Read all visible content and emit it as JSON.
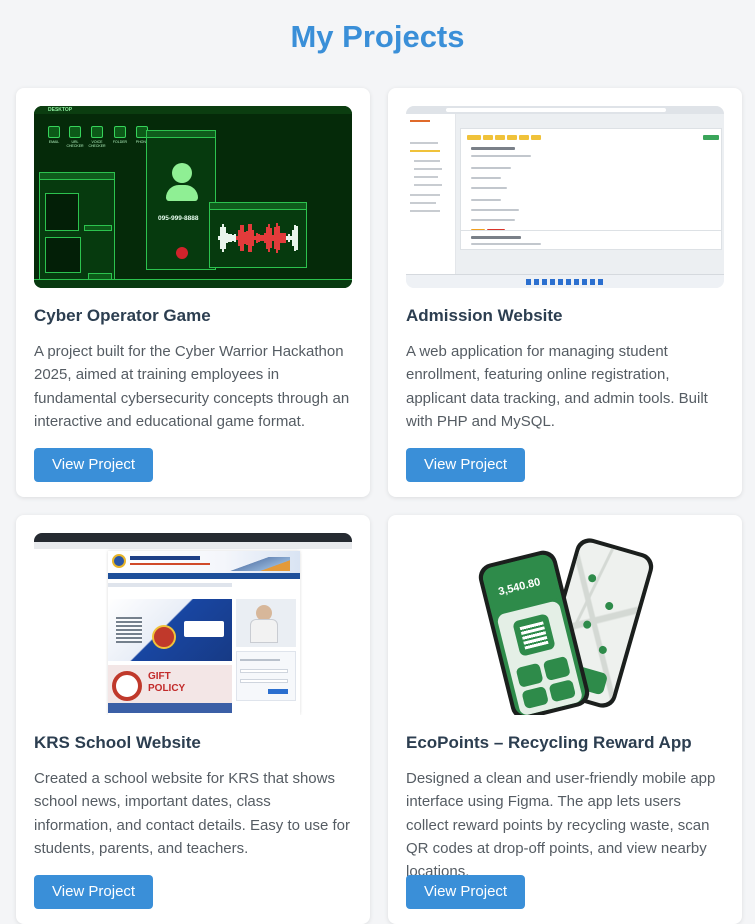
{
  "page": {
    "title": "My Projects"
  },
  "projects": [
    {
      "title": "Cyber Operator Game",
      "description": "A project built for the Cyber Warrior Hackathon 2025, aimed at training employees in fundamental cybersecurity concepts through an interactive and educational game format.",
      "button_label": "View Project",
      "thumbnail": {
        "desktop_label": "DESKTOP",
        "phone_number": "095-999-8888",
        "icon_labels": [
          "EMAIL",
          "URL CHECKER",
          "VOICE CHECKER",
          "FOLDER",
          "PHONE"
        ]
      }
    },
    {
      "title": "Admission Website",
      "description": "A web application for managing student enrollment, featuring online registration, applicant data tracking, and admin tools. Built with PHP and MySQL.",
      "button_label": "View Project"
    },
    {
      "title": "KRS School Website",
      "description": "Created a school website for KRS that shows school news, important dates, class information, and contact details. Easy to use for students, parents, and teachers.",
      "button_label": "View Project",
      "thumbnail": {
        "gift_text": "GIFT",
        "policy_text": "POLICY"
      }
    },
    {
      "title": "EcoPoints – Recycling Reward App",
      "description": "Designed a clean and user-friendly mobile app interface using Figma. The app lets users collect reward points by recycling waste, scan QR codes at drop-off points, and view nearby locations.",
      "button_label": "View Project",
      "thumbnail": {
        "points": "3,540.80"
      }
    }
  ],
  "colors": {
    "accent": "#3a8fd8",
    "background": "#f4f5f7",
    "card": "#ffffff",
    "heading": "#2c3e50",
    "body_text": "#555c63"
  }
}
